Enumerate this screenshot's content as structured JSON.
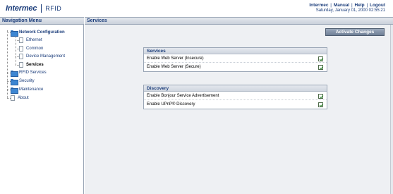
{
  "header": {
    "brand": "Intermec",
    "product": "RFID",
    "links": [
      "Intermec",
      "Manual",
      "Help",
      "Logout"
    ],
    "separator": "|",
    "datetime": "Saturday, January 01, 2000 02:55:21"
  },
  "nav": {
    "title": "Navigation Menu",
    "items": [
      {
        "label": "Network Configuration",
        "icon": "folder-icon"
      },
      {
        "label": "Ethernet",
        "icon": "page-icon"
      },
      {
        "label": "Common",
        "icon": "page-icon"
      },
      {
        "label": "Device Management",
        "icon": "page-icon"
      },
      {
        "label": "Services",
        "icon": "page-icon"
      },
      {
        "label": "RFID Services",
        "icon": "folder-icon"
      },
      {
        "label": "Security",
        "icon": "folder-icon"
      },
      {
        "label": "Maintenance",
        "icon": "folder-icon"
      },
      {
        "label": "About",
        "icon": "page-icon"
      }
    ]
  },
  "main": {
    "title": "Services",
    "activate_label": "Activate Changes",
    "groups": [
      {
        "title": "Services",
        "rows": [
          {
            "label": "Enable Web Server (Insecure)",
            "checked": true
          },
          {
            "label": "Enable Web Server (Secure)",
            "checked": true
          }
        ]
      },
      {
        "title": "Discovery",
        "rows": [
          {
            "label": "Enable Bonjour Service Advertisement",
            "checked": true
          },
          {
            "label": "Enable UPnP® Discovery",
            "checked": true
          }
        ]
      }
    ]
  },
  "colors": {
    "brand_blue": "#1a3c7a",
    "folder_blue": "#3d86d2",
    "check_green": "#2f8a2f",
    "button_gray": "#7f8ea4"
  }
}
